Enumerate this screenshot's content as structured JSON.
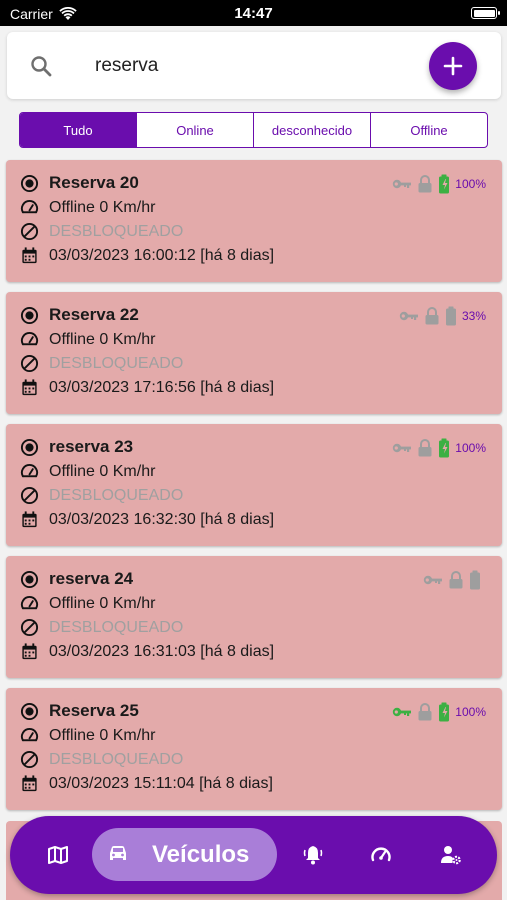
{
  "status_bar": {
    "carrier": "Carrier",
    "time": "14:47"
  },
  "search": {
    "value": "reserva",
    "placeholder": ""
  },
  "filters": [
    {
      "label": "Tudo",
      "active": true
    },
    {
      "label": "Online",
      "active": false
    },
    {
      "label": "desconhecido",
      "active": false
    },
    {
      "label": "Offline",
      "active": false
    }
  ],
  "colors": {
    "accent": "#6a0dad",
    "card_offline": "#e3aaaa",
    "battery_green": "#3cb043",
    "key_green": "#3cb043",
    "icon_gray": "#9e9e9e"
  },
  "vehicles": [
    {
      "name": "Reserva 20",
      "speed": "Offline 0 Km/hr",
      "lock_status": "DESBLOQUEADO",
      "datetime": "03/03/2023 16:00:12 [há 8 dias]",
      "battery": "100%",
      "battery_charging": true,
      "key_active": false
    },
    {
      "name": "Reserva 22",
      "speed": "Offline 0 Km/hr",
      "lock_status": "DESBLOQUEADO",
      "datetime": "03/03/2023 17:16:56 [há 8 dias]",
      "battery": "33%",
      "battery_charging": false,
      "key_active": false
    },
    {
      "name": "reserva 23",
      "speed": "Offline 0 Km/hr",
      "lock_status": "DESBLOQUEADO",
      "datetime": "03/03/2023 16:32:30 [há 8 dias]",
      "battery": "100%",
      "battery_charging": true,
      "key_active": false
    },
    {
      "name": "reserva 24",
      "speed": "Offline 0 Km/hr",
      "lock_status": "DESBLOQUEADO",
      "datetime": "03/03/2023 16:31:03 [há 8 dias]",
      "battery": "",
      "battery_charging": false,
      "key_active": false
    },
    {
      "name": "Reserva 25",
      "speed": "Offline 0 Km/hr",
      "lock_status": "DESBLOQUEADO",
      "datetime": "03/03/2023 15:11:04 [há 8 dias]",
      "battery": "100%",
      "battery_charging": true,
      "key_active": true
    }
  ],
  "bottom_nav": {
    "active_label": "Veículos",
    "items": [
      "map-icon",
      "car-icon",
      "bell-icon",
      "speedometer-icon",
      "user-settings-icon"
    ]
  }
}
